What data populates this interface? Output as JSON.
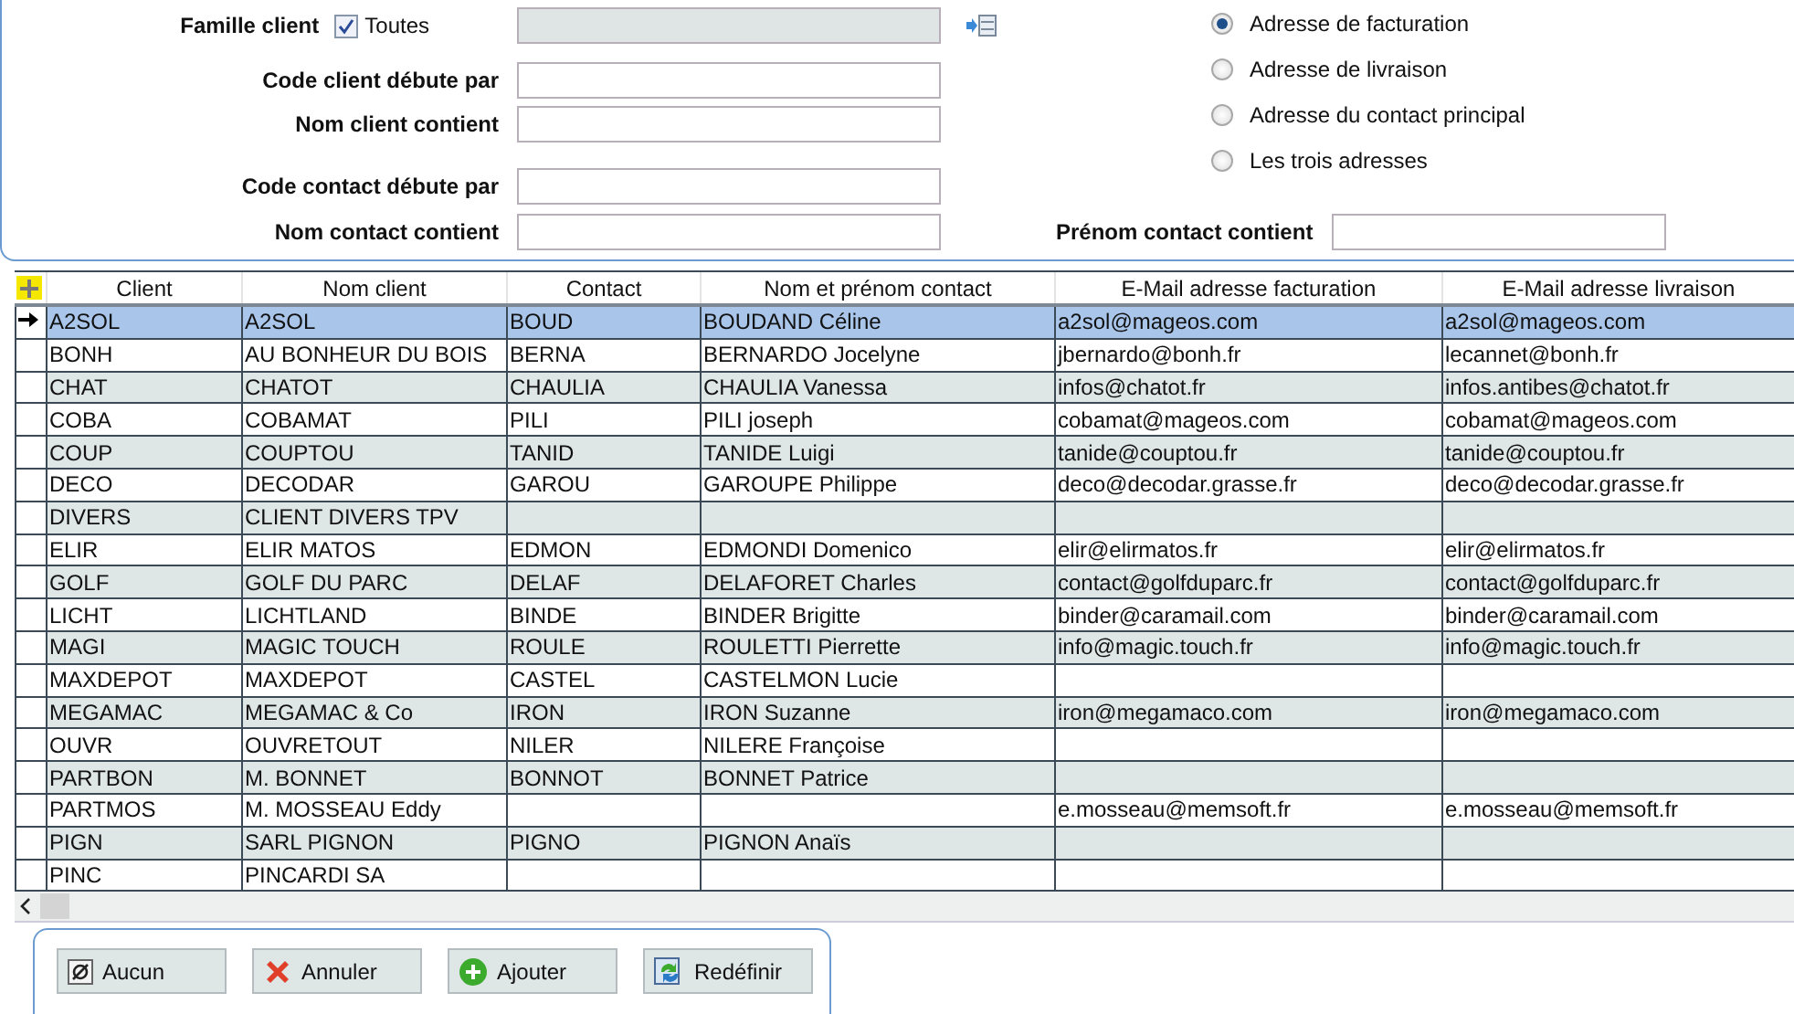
{
  "filters": {
    "famille": {
      "label": "Famille client",
      "checkbox": {
        "label": "Toutes",
        "checked": true
      },
      "field_disabled": true
    },
    "left_fields": [
      {
        "label": "Code client débute par"
      },
      {
        "label": "Nom client contient"
      },
      {
        "label": "Code contact débute par"
      },
      {
        "label": "Nom contact contient"
      }
    ],
    "address_options": [
      {
        "label": "Adresse de facturation",
        "selected": true
      },
      {
        "label": "Adresse de livraison",
        "selected": false
      },
      {
        "label": "Adresse du contact principal",
        "selected": false
      },
      {
        "label": "Les trois adresses",
        "selected": false
      }
    ],
    "prenom_field": {
      "label": "Prénom contact contient"
    }
  },
  "table": {
    "columns": [
      "Client",
      "Nom client",
      "Contact",
      "Nom et prénom contact",
      "E-Mail adresse facturation",
      "E-Mail adresse livraison"
    ],
    "rows": [
      {
        "selected": true,
        "cells": [
          "A2SOL",
          "A2SOL",
          "BOUD",
          "BOUDAND Céline",
          "a2sol@mageos.com",
          "a2sol@mageos.com"
        ]
      },
      {
        "selected": false,
        "cells": [
          "BONH",
          "AU BONHEUR DU BOIS",
          "BERNA",
          "BERNARDO Jocelyne",
          "jbernardo@bonh.fr",
          "lecannet@bonh.fr"
        ]
      },
      {
        "selected": false,
        "cells": [
          "CHAT",
          "CHATOT",
          "CHAULIA",
          "CHAULIA Vanessa",
          "infos@chatot.fr",
          "infos.antibes@chatot.fr"
        ]
      },
      {
        "selected": false,
        "cells": [
          "COBA",
          "COBAMAT",
          "PILI",
          "PILI joseph",
          "cobamat@mageos.com",
          "cobamat@mageos.com"
        ]
      },
      {
        "selected": false,
        "cells": [
          "COUP",
          "COUPTOU",
          "TANID",
          "TANIDE Luigi",
          "tanide@couptou.fr",
          "tanide@couptou.fr"
        ]
      },
      {
        "selected": false,
        "cells": [
          "DECO",
          "DECODAR",
          "GAROU",
          "GAROUPE Philippe",
          "deco@decodar.grasse.fr",
          "deco@decodar.grasse.fr"
        ]
      },
      {
        "selected": false,
        "cells": [
          "DIVERS",
          "CLIENT DIVERS TPV",
          null,
          null,
          null,
          null
        ]
      },
      {
        "selected": false,
        "cells": [
          "ELIR",
          "ELIR MATOS",
          "EDMON",
          "EDMONDI Domenico",
          "elir@elirmatos.fr",
          "elir@elirmatos.fr"
        ]
      },
      {
        "selected": false,
        "cells": [
          "GOLF",
          "GOLF DU PARC",
          "DELAF",
          "DELAFORET Charles",
          "contact@golfduparc.fr",
          "contact@golfduparc.fr"
        ]
      },
      {
        "selected": false,
        "cells": [
          "LICHT",
          "LICHTLAND",
          "BINDE",
          "BINDER Brigitte",
          "binder@caramail.com",
          "binder@caramail.com"
        ]
      },
      {
        "selected": false,
        "cells": [
          "MAGI",
          "MAGIC TOUCH",
          "ROULE",
          "ROULETTI Pierrette",
          "info@magic.touch.fr",
          "info@magic.touch.fr"
        ]
      },
      {
        "selected": false,
        "cells": [
          "MAXDEPOT",
          "MAXDEPOT",
          "CASTEL",
          "CASTELMON Lucie",
          null,
          null
        ]
      },
      {
        "selected": false,
        "cells": [
          "MEGAMAC",
          "MEGAMAC & Co",
          "IRON",
          "IRON Suzanne",
          "iron@megamaco.com",
          "iron@megamaco.com"
        ]
      },
      {
        "selected": false,
        "cells": [
          "OUVR",
          "OUVRETOUT",
          "NILER",
          "NILERE Françoise",
          null,
          null
        ]
      },
      {
        "selected": false,
        "cells": [
          "PARTBON",
          "M. BONNET",
          "BONNOT",
          "BONNET Patrice",
          null,
          null
        ]
      },
      {
        "selected": false,
        "cells": [
          "PARTMOS",
          "M. MOSSEAU Eddy",
          null,
          null,
          "e.mosseau@memsoft.fr",
          "e.mosseau@memsoft.fr"
        ]
      },
      {
        "selected": false,
        "cells": [
          "PIGN",
          "SARL PIGNON",
          "PIGNO",
          "PIGNON Anaïs",
          null,
          null
        ]
      },
      {
        "selected": false,
        "cells": [
          "PINC",
          "PINCARDI SA",
          null,
          null,
          null,
          null
        ]
      }
    ]
  },
  "buttons": [
    {
      "label": "Aucun",
      "kind": "none"
    },
    {
      "label": "Annuler",
      "kind": "cancel"
    },
    {
      "label": "Ajouter",
      "kind": "add"
    },
    {
      "label": "Redéfinir",
      "kind": "reset"
    }
  ]
}
